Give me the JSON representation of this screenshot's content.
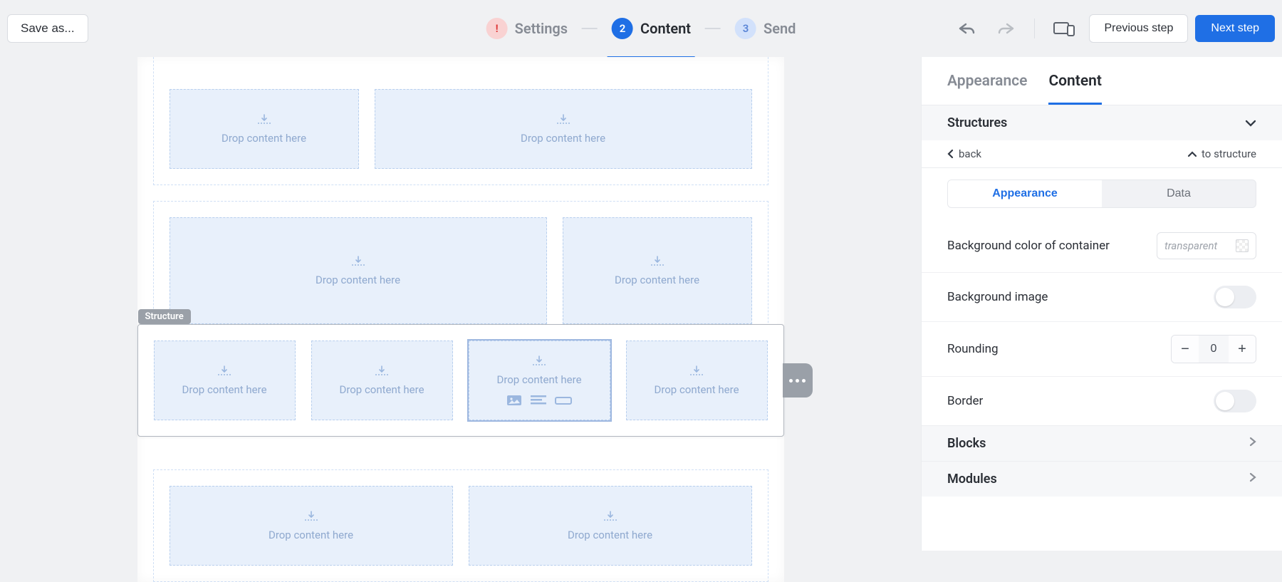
{
  "toolbar": {
    "save_label": "Save as...",
    "previous_label": "Previous step",
    "next_label": "Next step"
  },
  "steps": [
    {
      "icon": "!",
      "label": "Settings",
      "state": "warn"
    },
    {
      "num": "2",
      "label": "Content",
      "state": "active"
    },
    {
      "num": "3",
      "label": "Send",
      "state": "inactive"
    }
  ],
  "canvas": {
    "drop_label": "Drop content here",
    "structure_tag": "Structure"
  },
  "panel": {
    "tabs": {
      "appearance": "Appearance",
      "content": "Content",
      "active": "content"
    },
    "section_structures": "Structures",
    "breadcrumb": {
      "back": "back",
      "to_structure": "to structure"
    },
    "segmented": {
      "appearance": "Appearance",
      "data": "Data",
      "active": "appearance"
    },
    "props": {
      "bg_color": {
        "label": "Background color of container",
        "value": "transparent"
      },
      "bg_image": {
        "label": "Background image",
        "value": false
      },
      "rounding": {
        "label": "Rounding",
        "value": 0
      },
      "border": {
        "label": "Border",
        "value": false
      }
    },
    "sections": {
      "blocks": "Blocks",
      "modules": "Modules"
    }
  }
}
